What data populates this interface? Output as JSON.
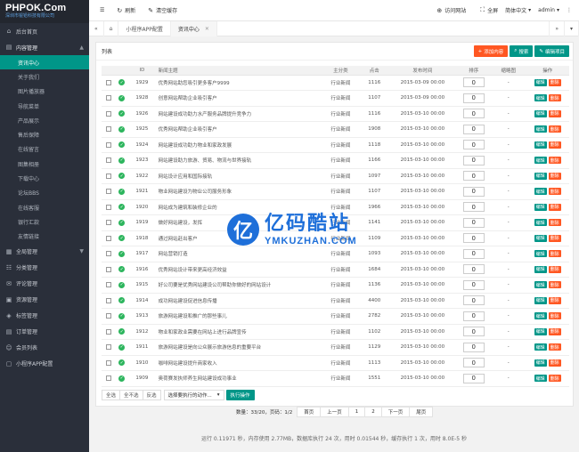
{
  "brand": {
    "name": "PHPOK.Com",
    "subtitle": "深圳市锟铻科技有限公司"
  },
  "sidebar": {
    "home": "后台首页",
    "content_group": "内容管理",
    "content_items": [
      "资讯中心",
      "关于我们",
      "图片播放器",
      "导航菜单",
      "产品展示",
      "售后保障",
      "在线留言",
      "图集相册",
      "下载中心",
      "论坛BBS",
      "在线客服",
      "银行汇款",
      "友情链接"
    ],
    "groups": [
      "全局管理",
      "分类管理",
      "评论管理",
      "资源管理",
      "标签管理",
      "订单管理",
      "会员列表",
      "小程序APP配置"
    ]
  },
  "topbar": {
    "refresh": "刷新",
    "clear_cache": "清空缓存",
    "visit_site": "访问网站",
    "fullscreen": "全屏",
    "language": "简体中文",
    "user": "admin"
  },
  "tabs": [
    {
      "label": "小程序APP配置"
    },
    {
      "label": "资讯中心"
    }
  ],
  "panel": {
    "title": "列表",
    "add_btn": "添加内容",
    "search_btn": "搜索",
    "edit_project_btn": "编辑项目"
  },
  "table": {
    "headers": [
      "ID",
      "新闻主题",
      "主分类",
      "点击",
      "发布时间",
      "排序",
      "缩略图",
      "操作"
    ],
    "rows": [
      {
        "id": "1929",
        "title": "优秀网站助您吸引更多客户9999",
        "cat": "行业新闻",
        "hits": "1116",
        "date": "2015-03-09 00:00",
        "sort": "0",
        "thumb": "-"
      },
      {
        "id": "1928",
        "title": "创意网站帮助企业吸引客户",
        "cat": "行业新闻",
        "hits": "1107",
        "date": "2015-03-09 00:00",
        "sort": "0",
        "thumb": "-"
      },
      {
        "id": "1926",
        "title": "网站建设成功助力水产服务品牌提升竞争力",
        "cat": "行业新闻",
        "hits": "1116",
        "date": "2015-03-10 00:00",
        "sort": "0",
        "thumb": "-"
      },
      {
        "id": "1925",
        "title": "优秀网站帮助企业吸引客户",
        "cat": "行业新闻",
        "hits": "1908",
        "date": "2015-03-10 00:00",
        "sort": "0",
        "thumb": "-"
      },
      {
        "id": "1924",
        "title": "网站建设成功助力物业和家政发展",
        "cat": "行业新闻",
        "hits": "1118",
        "date": "2015-03-10 00:00",
        "sort": "0",
        "thumb": "-"
      },
      {
        "id": "1923",
        "title": "网站建设助力旅游、贸易、物流与世界接轨",
        "cat": "行业新闻",
        "hits": "1166",
        "date": "2015-03-10 00:00",
        "sort": "0",
        "thumb": "-"
      },
      {
        "id": "1922",
        "title": "网站设计应用和国际接轨",
        "cat": "行业新闻",
        "hits": "1097",
        "date": "2015-03-10 00:00",
        "sort": "0",
        "thumb": "-"
      },
      {
        "id": "1921",
        "title": "物业网站建设为物业公司服务形象",
        "cat": "行业新闻",
        "hits": "1107",
        "date": "2015-03-10 00:00",
        "sort": "0",
        "thumb": "-"
      },
      {
        "id": "1920",
        "title": "网站成为建筑和装修企业的",
        "cat": "行业新闻",
        "hits": "1966",
        "date": "2015-03-10 00:00",
        "sort": "0",
        "thumb": "-"
      },
      {
        "id": "1919",
        "title": "做好网站建设，发挥",
        "cat": "行业新闻",
        "hits": "1141",
        "date": "2015-03-10 00:00",
        "sort": "0",
        "thumb": "-"
      },
      {
        "id": "1918",
        "title": "通过网站赶出客户",
        "cat": "行业新闻",
        "hits": "1109",
        "date": "2015-03-10 00:00",
        "sort": "0",
        "thumb": "-"
      },
      {
        "id": "1917",
        "title": "网站营销打造",
        "cat": "行业新闻",
        "hits": "1093",
        "date": "2015-03-10 00:00",
        "sort": "0",
        "thumb": "-"
      },
      {
        "id": "1916",
        "title": "优秀网站设计带来更高经济效益",
        "cat": "行业新闻",
        "hits": "1684",
        "date": "2015-03-10 00:00",
        "sort": "0",
        "thumb": "-"
      },
      {
        "id": "1915",
        "title": "好公司要是优秀网站建设公司帮助你做好的网站设计",
        "cat": "行业新闻",
        "hits": "1136",
        "date": "2015-03-10 00:00",
        "sort": "0",
        "thumb": "-"
      },
      {
        "id": "1914",
        "title": "成功网站建设促进信息传播",
        "cat": "行业新闻",
        "hits": "4400",
        "date": "2015-03-10 00:00",
        "sort": "0",
        "thumb": "-"
      },
      {
        "id": "1913",
        "title": "旅游网站建设和推广的那些事儿",
        "cat": "行业新闻",
        "hits": "2782",
        "date": "2015-03-10 00:00",
        "sort": "0",
        "thumb": "-"
      },
      {
        "id": "1912",
        "title": "物业和家政业需要在网站上进行品牌宣传",
        "cat": "行业新闻",
        "hits": "1102",
        "date": "2015-03-10 00:00",
        "sort": "0",
        "thumb": "-"
      },
      {
        "id": "1911",
        "title": "旅游网站建设是向公众展示旅游信息的重要平台",
        "cat": "行业新闻",
        "hits": "1129",
        "date": "2015-03-10 00:00",
        "sort": "0",
        "thumb": "-"
      },
      {
        "id": "1910",
        "title": "咖啡网站建设提升商家收入",
        "cat": "行业新闻",
        "hits": "1113",
        "date": "2015-03-10 00:00",
        "sort": "0",
        "thumb": "-"
      },
      {
        "id": "1909",
        "title": "奥荷赛发执师养生网站建设成功事业",
        "cat": "行业新闻",
        "hits": "1551",
        "date": "2015-03-10 00:00",
        "sort": "0",
        "thumb": "-"
      }
    ],
    "edit_label": "编辑",
    "delete_label": "删除"
  },
  "bulk": {
    "select_all": "全选",
    "select_none": "全不选",
    "invert": "反选",
    "action_placeholder": "选择要执行的动作...",
    "execute": "执行操作"
  },
  "pager": {
    "info": "数量：33/20，页码：1/2",
    "first": "首页",
    "prev": "上一页",
    "pages": [
      "1",
      "2"
    ],
    "next": "下一页",
    "last": "尾页"
  },
  "footer": {
    "text": "运行 0.11971 秒，内存使用 2.77MB，数据库执行 24 次，用时 0.01544 秒，缓存执行 1 次，用时 8.0E-5 秒"
  },
  "watermark": {
    "cn": "亿码酷站",
    "en": "YMKUZHAN.COM"
  },
  "colors": {
    "sidebar_bg": "#2a2f3a",
    "accent": "#009688",
    "danger": "#ff5722",
    "info": "#1e9fff"
  }
}
